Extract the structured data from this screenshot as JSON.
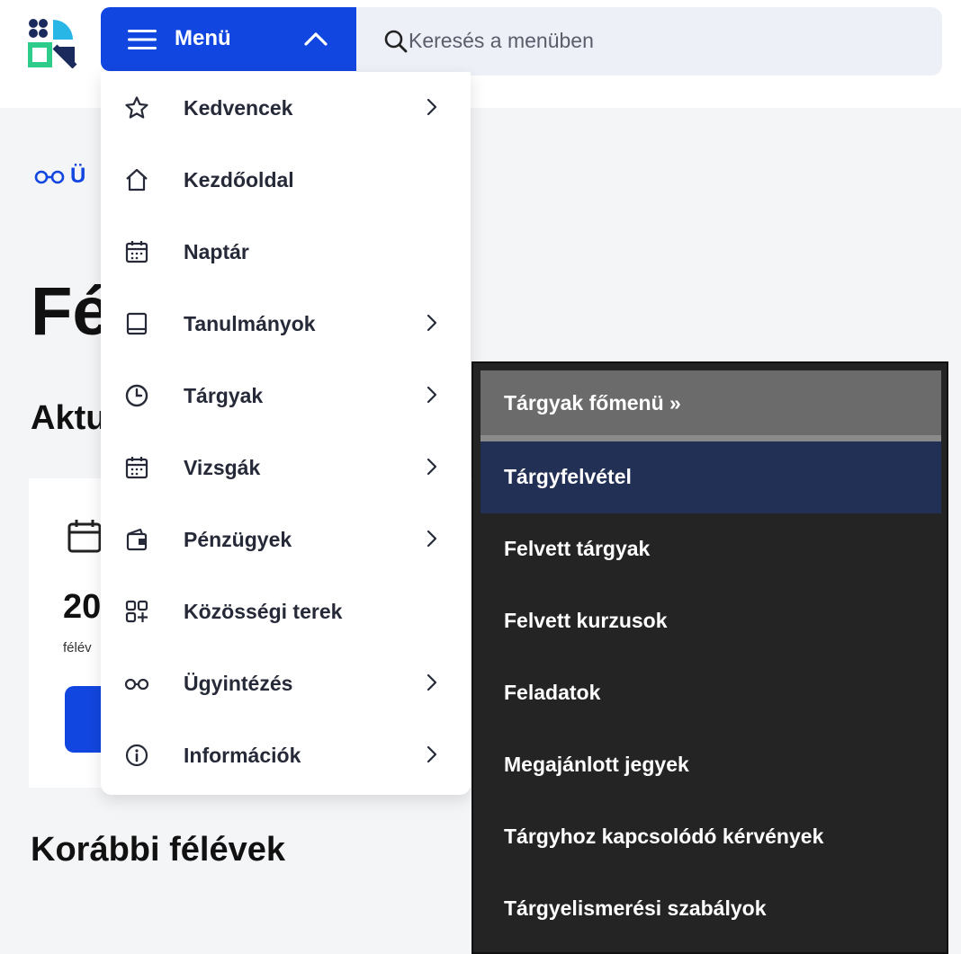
{
  "header": {
    "menu_label": "Menü",
    "search": {
      "placeholder": "Keresés a menüben",
      "value": ""
    }
  },
  "background": {
    "breadcrumb": "Ü",
    "title": "Fé ztráció",
    "subtitle": "Aktu",
    "card_year": "20",
    "card_sub": "félév",
    "previous_heading": "Korábbi félévek"
  },
  "menu": {
    "items": [
      {
        "label": "Kedvencek",
        "icon": "star-icon",
        "has_submenu": true
      },
      {
        "label": "Kezdőoldal",
        "icon": "home-icon",
        "has_submenu": false
      },
      {
        "label": "Naptár",
        "icon": "calendar-icon",
        "has_submenu": false
      },
      {
        "label": "Tanulmányok",
        "icon": "book-icon",
        "has_submenu": true
      },
      {
        "label": "Tárgyak",
        "icon": "clock-icon",
        "has_submenu": true
      },
      {
        "label": "Vizsgák",
        "icon": "calendar-icon",
        "has_submenu": true
      },
      {
        "label": "Pénzügyek",
        "icon": "wallet-icon",
        "has_submenu": true
      },
      {
        "label": "Közösségi terek",
        "icon": "grid-plus-icon",
        "has_submenu": false
      },
      {
        "label": "Ügyintézés",
        "icon": "glasses-icon",
        "has_submenu": true
      },
      {
        "label": "Információk",
        "icon": "info-icon",
        "has_submenu": true
      }
    ]
  },
  "submenu": {
    "header": "Tárgyak főmenü »",
    "items": [
      {
        "label": "Tárgyfelvétel",
        "active": true
      },
      {
        "label": "Felvett tárgyak",
        "active": false
      },
      {
        "label": "Felvett kurzusok",
        "active": false
      },
      {
        "label": "Feladatok",
        "active": false
      },
      {
        "label": "Megajánlott jegyek",
        "active": false
      },
      {
        "label": "Tárgyhoz kapcsolódó kérvények",
        "active": false
      },
      {
        "label": "Tárgyelismerési szabályok",
        "active": false
      }
    ]
  },
  "colors": {
    "accent": "#1246e0",
    "submenu_bg": "#242424",
    "submenu_active": "#223055",
    "submenu_header": "#6b6b6b"
  }
}
